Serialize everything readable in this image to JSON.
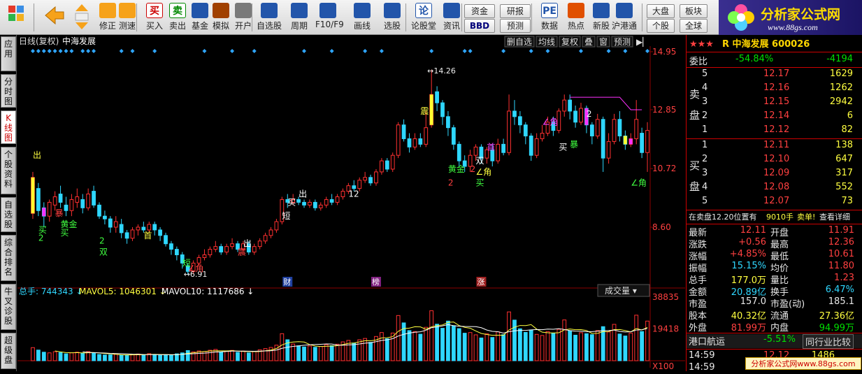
{
  "toolbar": {
    "items": [
      {
        "label": "修正",
        "icon": "up-arrow-icon"
      },
      {
        "label": "测速",
        "icon": "clock-icon"
      },
      {
        "label": "买入",
        "icon": "buy-icon",
        "glyph": "买"
      },
      {
        "label": "卖出",
        "icon": "sell-icon",
        "glyph": "卖"
      },
      {
        "label": "基金",
        "icon": "fund-icon"
      },
      {
        "label": "模拟",
        "icon": "hammer-icon"
      },
      {
        "label": "开户",
        "icon": "lock-icon"
      },
      {
        "label": "自选股",
        "icon": "star-folder-icon"
      },
      {
        "label": "周期",
        "icon": "period-icon"
      },
      {
        "label": "F10/F9",
        "icon": "f10-icon"
      },
      {
        "label": "画线",
        "icon": "pen-icon"
      },
      {
        "label": "选股",
        "icon": "chart-icon"
      },
      {
        "label": "论股堂",
        "icon": "forum-icon",
        "glyph": "论"
      },
      {
        "label": "资讯",
        "icon": "news-icon"
      },
      {
        "label": "数据",
        "icon": "pe-icon",
        "glyph": "PE"
      },
      {
        "label": "热点",
        "icon": "fire-icon"
      },
      {
        "label": "新股",
        "icon": "new-stock-icon"
      },
      {
        "label": "沪港通",
        "icon": "shhk-icon"
      }
    ],
    "small_buttons": {
      "zijin": "资金",
      "bbd": "BBD",
      "yanbao": "研报",
      "yuce": "预测",
      "dapan": "大盘",
      "bankuai": "板块",
      "gegu": "个股",
      "quanqiu": "全球"
    }
  },
  "brand": {
    "title": "分析家公式网",
    "url": "www.88gs.com"
  },
  "left_tabs": [
    "应用",
    "分时图",
    "K线图",
    "个股资料",
    "自选股",
    "综合排名",
    "牛叉诊股",
    "超级盘"
  ],
  "chart_header": {
    "title": "日线(复权)",
    "stock": "中海发展"
  },
  "chart_menu": [
    "删自选",
    "均线",
    "复权",
    "叠",
    "窗",
    "预测"
  ],
  "price_axis": [
    "14.95",
    "12.85",
    "10.72",
    "8.60"
  ],
  "volume_axis": [
    "38835",
    "19418",
    "X100"
  ],
  "volume_header": {
    "total": "总手: 744343",
    "mavol5": "MAVOL5: 1046301",
    "mavol10": "MAVOL10: 1117686"
  },
  "volume_dropdown": "成交量",
  "events": [
    "财",
    "榜",
    "涨"
  ],
  "annotations": {
    "high": "14.26",
    "low": "6.91"
  },
  "signals": [
    "出",
    "买",
    "2",
    "暴",
    "黄金",
    "买",
    "2",
    "双",
    "首",
    "短",
    "∠角",
    "出",
    "震",
    "短",
    "出",
    "买",
    "12",
    "震",
    "黄金",
    "2",
    "双",
    "∠角",
    "买",
    "2",
    "首",
    "暴",
    "∠角",
    "买",
    "2",
    "∠角"
  ],
  "quote": {
    "stock_line": "R 中海发展 600026",
    "weibi_label": "委比",
    "weibi_pct": "-54.84%",
    "weibi_val": "-4194",
    "sell_label": "卖盘",
    "buy_label": "买盘",
    "sell": [
      {
        "lvl": "5",
        "price": "12.17",
        "vol": "1629"
      },
      {
        "lvl": "4",
        "price": "12.16",
        "vol": "1262"
      },
      {
        "lvl": "3",
        "price": "12.15",
        "vol": "2942"
      },
      {
        "lvl": "2",
        "price": "12.14",
        "vol": "6"
      },
      {
        "lvl": "1",
        "price": "12.12",
        "vol": "82"
      }
    ],
    "buy": [
      {
        "lvl": "1",
        "price": "12.11",
        "vol": "138"
      },
      {
        "lvl": "2",
        "price": "12.10",
        "vol": "647"
      },
      {
        "lvl": "3",
        "price": "12.09",
        "vol": "317"
      },
      {
        "lvl": "4",
        "price": "12.08",
        "vol": "552"
      },
      {
        "lvl": "5",
        "price": "12.07",
        "vol": "73"
      }
    ],
    "notice_a": "在卖盘12.20位置有",
    "notice_b": "9010手",
    "notice_c": "卖单!",
    "notice_d": "查看详细",
    "stats": [
      [
        "最新",
        "12.11",
        "开盘",
        "11.91"
      ],
      [
        "涨跌",
        "+0.56",
        "最高",
        "12.36"
      ],
      [
        "涨幅",
        "+4.85%",
        "最低",
        "10.61"
      ],
      [
        "振幅",
        "15.15%",
        "均价",
        "11.80"
      ],
      [
        "总手",
        "177.0万",
        "量比",
        "1.23"
      ],
      [
        "金额",
        "20.89亿",
        "换手",
        "6.47%"
      ],
      [
        "市盈",
        "157.0",
        "市盈(动)",
        "185.1"
      ],
      [
        "股本",
        "40.32亿",
        "流通",
        "27.36亿"
      ],
      [
        "外盘",
        "81.99万",
        "内盘",
        "94.99万"
      ]
    ],
    "sector_name": "港口航运",
    "sector_pct": "-5.51%",
    "peer": "同行业比较",
    "ticks": [
      {
        "time": "14:59",
        "price": "12.12",
        "vol": "1486"
      },
      {
        "time": "14:59",
        "price": "",
        "vol": ""
      }
    ],
    "watermark": "分析家公式网www.88gs.com"
  },
  "colors": {
    "up": "#ff3030",
    "down": "#2fd7ff",
    "bg": "#000000",
    "grid": "#8b0000"
  },
  "chart_data": {
    "type": "candlestick",
    "price_range": [
      6.5,
      15.1
    ],
    "candles": [
      [
        9.1,
        10.4,
        10.6,
        8.9
      ],
      [
        10.0,
        9.2,
        10.2,
        9.0
      ],
      [
        9.3,
        9.0,
        9.5,
        8.6
      ],
      [
        9.0,
        9.5,
        9.6,
        8.8
      ],
      [
        9.4,
        9.7,
        9.9,
        9.2
      ],
      [
        9.8,
        9.5,
        10.1,
        9.3
      ],
      [
        9.4,
        9.2,
        9.7,
        9.0
      ],
      [
        9.2,
        9.6,
        9.8,
        9.0
      ],
      [
        9.5,
        9.7,
        10.0,
        9.3
      ],
      [
        9.6,
        9.3,
        9.8,
        9.1
      ],
      [
        9.3,
        9.8,
        10.0,
        9.2
      ],
      [
        9.9,
        9.4,
        10.1,
        9.3
      ],
      [
        9.4,
        9.0,
        9.5,
        8.9
      ],
      [
        9.0,
        8.9,
        9.2,
        8.7
      ],
      [
        8.9,
        8.6,
        9.0,
        8.4
      ],
      [
        8.6,
        8.8,
        9.0,
        8.4
      ],
      [
        8.7,
        8.4,
        8.9,
        8.2
      ],
      [
        8.4,
        8.2,
        8.5,
        8.0
      ],
      [
        8.2,
        8.5,
        8.6,
        8.1
      ],
      [
        8.5,
        8.6,
        8.7,
        8.3
      ],
      [
        8.6,
        8.5,
        8.8,
        8.4
      ],
      [
        8.5,
        8.7,
        8.8,
        8.4
      ],
      [
        8.7,
        8.5,
        8.8,
        8.3
      ],
      [
        8.5,
        8.3,
        8.6,
        8.1
      ],
      [
        8.3,
        8.0,
        8.4,
        7.9
      ],
      [
        8.0,
        7.8,
        8.1,
        7.6
      ],
      [
        7.8,
        7.6,
        7.9,
        7.4
      ],
      [
        7.6,
        7.3,
        7.7,
        7.1
      ],
      [
        7.2,
        7.0,
        7.3,
        6.9
      ],
      [
        7.0,
        7.3,
        7.4,
        6.9
      ],
      [
        7.3,
        7.5,
        7.6,
        7.2
      ],
      [
        7.5,
        7.6,
        7.8,
        7.4
      ],
      [
        7.6,
        7.8,
        7.9,
        7.5
      ],
      [
        7.8,
        7.9,
        8.1,
        7.7
      ],
      [
        7.9,
        7.7,
        8.0,
        7.6
      ],
      [
        7.7,
        7.9,
        8.0,
        7.6
      ],
      [
        7.9,
        8.0,
        8.2,
        7.8
      ],
      [
        8.0,
        7.8,
        8.1,
        7.7
      ],
      [
        7.8,
        8.0,
        8.1,
        7.7
      ],
      [
        8.0,
        7.7,
        8.1,
        7.6
      ],
      [
        7.7,
        7.9,
        8.0,
        7.6
      ],
      [
        7.9,
        8.1,
        8.2,
        7.8
      ],
      [
        8.1,
        8.3,
        8.4,
        8.0
      ],
      [
        8.3,
        8.5,
        8.6,
        8.2
      ],
      [
        8.5,
        8.8,
        8.9,
        8.4
      ],
      [
        8.8,
        9.6,
        9.7,
        8.7
      ],
      [
        9.6,
        9.5,
        9.8,
        9.3
      ],
      [
        9.5,
        9.6,
        9.8,
        9.4
      ],
      [
        9.6,
        9.5,
        9.7,
        9.4
      ],
      [
        9.5,
        9.4,
        9.6,
        9.3
      ],
      [
        9.4,
        9.5,
        9.6,
        9.3
      ],
      [
        9.5,
        9.3,
        9.6,
        9.2
      ],
      [
        9.3,
        9.4,
        9.5,
        9.2
      ],
      [
        9.4,
        9.6,
        9.7,
        9.3
      ],
      [
        9.6,
        9.5,
        9.8,
        9.4
      ],
      [
        9.5,
        9.7,
        9.8,
        9.4
      ],
      [
        9.7,
        9.9,
        10.0,
        9.6
      ],
      [
        9.9,
        10.1,
        10.2,
        9.8
      ],
      [
        10.1,
        10.0,
        10.3,
        9.9
      ],
      [
        10.0,
        10.3,
        10.4,
        9.9
      ],
      [
        10.3,
        10.4,
        10.6,
        10.2
      ],
      [
        10.4,
        10.2,
        10.5,
        10.1
      ],
      [
        10.2,
        10.6,
        10.7,
        10.1
      ],
      [
        10.6,
        11.0,
        11.1,
        10.5
      ],
      [
        11.0,
        10.7,
        11.1,
        10.6
      ],
      [
        10.7,
        11.2,
        11.3,
        10.6
      ],
      [
        11.2,
        12.3,
        12.4,
        11.1
      ],
      [
        12.3,
        11.8,
        12.5,
        11.7
      ],
      [
        11.8,
        11.5,
        12.0,
        11.3
      ],
      [
        11.5,
        11.8,
        12.0,
        11.4
      ],
      [
        11.8,
        11.6,
        12.0,
        11.5
      ],
      [
        11.6,
        12.2,
        12.8,
        11.5
      ],
      [
        12.3,
        13.4,
        14.3,
        12.2
      ],
      [
        13.5,
        13.1,
        13.7,
        12.8
      ],
      [
        13.1,
        12.6,
        13.2,
        12.3
      ],
      [
        12.6,
        12.2,
        12.8,
        11.9
      ],
      [
        12.2,
        11.6,
        12.3,
        11.4
      ],
      [
        11.6,
        11.0,
        11.7,
        10.8
      ],
      [
        11.0,
        10.8,
        11.2,
        10.6
      ],
      [
        10.8,
        11.2,
        11.4,
        10.6
      ],
      [
        11.2,
        11.5,
        11.6,
        11.0
      ],
      [
        11.5,
        11.1,
        11.6,
        10.9
      ],
      [
        11.1,
        11.4,
        11.5,
        10.9
      ],
      [
        11.4,
        11.0,
        11.6,
        10.8
      ],
      [
        11.0,
        11.6,
        11.8,
        10.9
      ],
      [
        11.6,
        11.3,
        11.8,
        11.2
      ],
      [
        11.3,
        12.8,
        13.4,
        11.2
      ],
      [
        12.8,
        12.6,
        13.2,
        12.3
      ],
      [
        12.6,
        12.3,
        12.8,
        12.0
      ],
      [
        12.3,
        11.9,
        12.4,
        11.6
      ],
      [
        11.9,
        11.2,
        12.0,
        11.0
      ],
      [
        11.2,
        11.8,
        12.0,
        11.1
      ],
      [
        11.8,
        12.0,
        12.3,
        11.7
      ],
      [
        12.0,
        12.4,
        12.6,
        11.9
      ],
      [
        12.4,
        12.1,
        12.6,
        11.9
      ],
      [
        12.1,
        12.8,
        12.9,
        12.0
      ],
      [
        12.8,
        13.2,
        13.4,
        12.6
      ],
      [
        13.2,
        12.8,
        13.4,
        12.5
      ],
      [
        12.8,
        12.4,
        13.0,
        12.2
      ],
      [
        12.4,
        12.9,
        13.1,
        12.3
      ],
      [
        12.9,
        12.3,
        13.0,
        12.0
      ],
      [
        12.3,
        11.9,
        12.4,
        11.6
      ],
      [
        11.9,
        12.5,
        12.7,
        11.8
      ],
      [
        12.5,
        11.1,
        12.6,
        10.6
      ],
      [
        11.1,
        11.7,
        12.0,
        10.9
      ],
      [
        11.7,
        12.5,
        12.7,
        11.6
      ],
      [
        12.5,
        11.9,
        12.8,
        11.7
      ],
      [
        11.9,
        11.6,
        12.1,
        11.4
      ],
      [
        11.6,
        11.8,
        12.0,
        11.5
      ],
      [
        11.8,
        12.5,
        13.2,
        11.6
      ],
      [
        12.0,
        11.3,
        12.2,
        11.1
      ],
      [
        11.3,
        12.1,
        12.4,
        10.6
      ]
    ],
    "volume_range": [
      0,
      38835
    ],
    "volume": [
      8000,
      6500,
      5200,
      4800,
      5500,
      5000,
      4200,
      4800,
      5200,
      4500,
      5600,
      4700,
      3800,
      3500,
      3600,
      3900,
      3400,
      3200,
      3800,
      4100,
      3700,
      4300,
      3600,
      3300,
      3700,
      3500,
      4200,
      4800,
      6200,
      5400,
      6000,
      5600,
      6400,
      6900,
      5200,
      5800,
      6300,
      5100,
      5900,
      4800,
      5600,
      6700,
      7400,
      8100,
      9500,
      16500,
      12800,
      10200,
      9100,
      8400,
      9000,
      8200,
      8700,
      9800,
      9200,
      10100,
      11500,
      12400,
      10800,
      12800,
      13600,
      11200,
      14800,
      17200,
      13400,
      16900,
      27600,
      23100,
      18400,
      17800,
      16200,
      20400,
      30500,
      22300,
      19800,
      24200,
      21400,
      19600,
      16800,
      17200,
      15800,
      13900,
      16400,
      14200,
      17600,
      15900,
      29800,
      24800,
      19500,
      17300,
      18800,
      16100,
      15400,
      17800,
      16800,
      19200,
      24900,
      18200,
      15600,
      17100,
      16500,
      15900,
      18400,
      20800,
      17600,
      22200,
      16300,
      15100,
      16900,
      27800,
      17800,
      24200
    ]
  }
}
